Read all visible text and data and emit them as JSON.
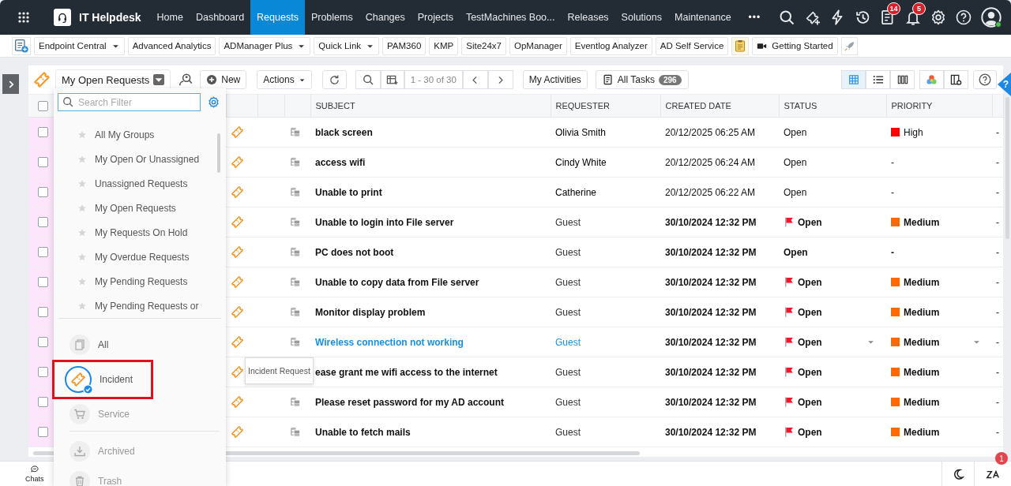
{
  "app": {
    "title": "IT Helpdesk"
  },
  "nav": [
    {
      "label": "Home",
      "selected": false
    },
    {
      "label": "Dashboard",
      "selected": false
    },
    {
      "label": "Requests",
      "selected": true
    },
    {
      "label": "Problems",
      "selected": false
    },
    {
      "label": "Changes",
      "selected": false
    },
    {
      "label": "Projects",
      "selected": false
    },
    {
      "label": "TestMachines Boo...",
      "selected": false
    },
    {
      "label": "Releases",
      "selected": false
    },
    {
      "label": "Solutions",
      "selected": false
    },
    {
      "label": "Maintenance",
      "selected": false
    }
  ],
  "nav_more": "•••",
  "header_actions": [
    {
      "kind": "search"
    },
    {
      "kind": "add-ticket"
    },
    {
      "kind": "bolt"
    },
    {
      "kind": "history"
    },
    {
      "kind": "tasks",
      "badge": "14"
    },
    {
      "kind": "bell",
      "badge": "5"
    },
    {
      "kind": "settings"
    },
    {
      "kind": "help"
    },
    {
      "kind": "avatar",
      "online": true
    }
  ],
  "quick_links": [
    {
      "kind": "add"
    },
    {
      "kind": "link",
      "label": "Endpoint Central",
      "dropdown": true
    },
    {
      "kind": "link",
      "label": "Advanced Analytics",
      "dropdown": false
    },
    {
      "kind": "link",
      "label": "ADManager Plus",
      "dropdown": true
    },
    {
      "kind": "link",
      "label": "Quick Link",
      "dropdown": true
    },
    {
      "kind": "link",
      "label": "PAM360",
      "dropdown": false
    },
    {
      "kind": "link",
      "label": "KMP",
      "dropdown": false
    },
    {
      "kind": "link",
      "label": "Site24x7",
      "dropdown": false
    },
    {
      "kind": "link",
      "label": "OpManager",
      "dropdown": false
    },
    {
      "kind": "link",
      "label": "Eventlog Analyzer",
      "dropdown": false
    },
    {
      "kind": "link",
      "label": "AD Self Service",
      "dropdown": false
    },
    {
      "kind": "note"
    },
    {
      "kind": "video",
      "label": "Getting Started"
    },
    {
      "kind": "rocket"
    }
  ],
  "toolbar": {
    "view_title": "My Open Requests",
    "new": "New",
    "actions": "Actions",
    "pagination": "1 - 30 of 30",
    "my_activities": "My Activities",
    "all_tasks": "All Tasks",
    "task_count": "296",
    "layouts": [
      {
        "kind": "grid",
        "selected": true
      },
      {
        "kind": "list",
        "selected": false
      },
      {
        "kind": "columns",
        "selected": false
      }
    ]
  },
  "table": {
    "header_checked": false,
    "columns": [
      "SUBJECT",
      "REQUESTER",
      "CREATED DATE",
      "STATUS",
      "PRIORITY"
    ],
    "rows": [
      {
        "checked": false,
        "subject": "black screen",
        "requester": "Olivia Smith",
        "created": "20/12/2025 06:25 AM",
        "status": "Open",
        "flagged": false,
        "priority": "High",
        "color": "#ff0000",
        "unread": false,
        "hovered": false,
        "column_10": "-"
      },
      {
        "checked": false,
        "subject": "access wifi",
        "requester": "Cindy White",
        "created": "20/12/2025 06:24 AM",
        "status": "Open",
        "flagged": false,
        "priority": "-",
        "unread": false,
        "hovered": false,
        "column_10": "-"
      },
      {
        "checked": false,
        "subject": "Unable to print",
        "requester": "Catherine",
        "created": "20/12/2025 06:22 AM",
        "status": "Open",
        "flagged": false,
        "priority": "-",
        "unread": false,
        "hovered": false,
        "column_10": "-"
      },
      {
        "checked": false,
        "subject": "Unable to login into File server",
        "requester": "Guest",
        "created": "30/10/2024 12:32 PM",
        "status": "Open",
        "flagged": true,
        "priority": "Medium",
        "color": "#ff6a00",
        "unread": true,
        "hovered": false,
        "column_10": "-"
      },
      {
        "checked": false,
        "subject": "PC does not boot",
        "requester": "Guest",
        "created": "30/10/2024 12:32 PM",
        "status": "Open",
        "flagged": false,
        "priority": "-",
        "unread": true,
        "hovered": false,
        "column_10": "-"
      },
      {
        "checked": false,
        "subject": "Unable to copy data from File server",
        "requester": "Guest",
        "created": "30/10/2024 12:32 PM",
        "status": "Open",
        "flagged": true,
        "priority": "Medium",
        "color": "#ff6a00",
        "unread": true,
        "hovered": false,
        "column_10": "-"
      },
      {
        "checked": false,
        "subject": "Monitor display problem",
        "requester": "Guest",
        "created": "30/10/2024 12:32 PM",
        "status": "Open",
        "flagged": true,
        "priority": "Medium",
        "color": "#ff6a00",
        "unread": true,
        "hovered": false,
        "column_10": "-"
      },
      {
        "checked": false,
        "subject": "Wireless connection not working",
        "requester": "Guest",
        "created": "30/10/2024 12:32 PM",
        "status": "Open",
        "flagged": true,
        "priority": "Medium",
        "color": "#ff6a00",
        "unread": true,
        "hovered": true,
        "column_10": "-"
      },
      {
        "checked": false,
        "subject": "ease grant me wifi access to the internet",
        "requester": "Guest",
        "created": "30/10/2024 12:32 PM",
        "status": "Open",
        "flagged": true,
        "priority": "Medium",
        "color": "#ff6a00",
        "unread": true,
        "hovered": false,
        "column_10": "-",
        "tooltip": "Incident Request"
      },
      {
        "checked": false,
        "subject": "Please reset password for my AD account",
        "requester": "Guest",
        "created": "30/10/2024 12:32 PM",
        "status": "Open",
        "flagged": true,
        "priority": "Medium",
        "color": "#ff6a00",
        "unread": true,
        "hovered": false,
        "column_10": "-"
      },
      {
        "checked": false,
        "subject": "Unable to fetch mails",
        "requester": "Guest",
        "created": "30/10/2024 12:32 PM",
        "status": "Open",
        "flagged": true,
        "priority": "Medium",
        "color": "#ff6a00",
        "unread": true,
        "hovered": false,
        "column_10": "-"
      }
    ]
  },
  "filter_menu": {
    "placeholder": "Search Filter",
    "filters": [
      "All My Groups",
      "My Open Or Unassigned",
      "Unassigned Requests",
      "My Open Requests",
      "My Requests On Hold",
      "My Overdue Requests",
      "My Pending Requests",
      "My Pending Requests or"
    ],
    "categories": [
      {
        "kind": "all",
        "label": "All",
        "selected": false,
        "highlighted": false
      },
      {
        "kind": "incident",
        "label": "Incident",
        "selected": true,
        "highlighted": true
      },
      {
        "kind": "service",
        "label": "Service",
        "selected": false,
        "highlighted": false
      },
      {
        "kind": "archived",
        "label": "Archived",
        "selected": false,
        "highlighted": false
      },
      {
        "kind": "trash",
        "label": "Trash",
        "selected": false,
        "highlighted": false
      }
    ]
  },
  "help_tab": "?",
  "footer": {
    "chats": "Chats",
    "notification_badge": "1"
  }
}
